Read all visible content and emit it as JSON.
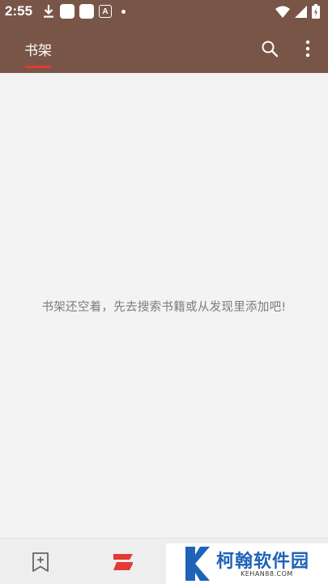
{
  "status_bar": {
    "time": "2:55",
    "left_icons": [
      "download-icon",
      "app-square-icon",
      "app-square-icon",
      "app-a-icon",
      "dot-icon"
    ],
    "app_a_letter": "A",
    "right_icons": [
      "wifi-icon",
      "cellular-signal-icon",
      "battery-icon"
    ]
  },
  "app_bar": {
    "tab_label": "书架",
    "actions": [
      "search-icon",
      "more-vert-icon"
    ],
    "color": "#795548",
    "indicator_color": "#e53935"
  },
  "main": {
    "empty_message": "书架还空着，先去搜索书籍或从发现里添加吧!"
  },
  "bottom_nav": {
    "items": [
      "bookmark-add-icon",
      "discover-icon"
    ],
    "accent_color": "#e53935"
  },
  "watermark": {
    "text": "柯翰软件园",
    "sub": "KEHAN88.COM"
  }
}
